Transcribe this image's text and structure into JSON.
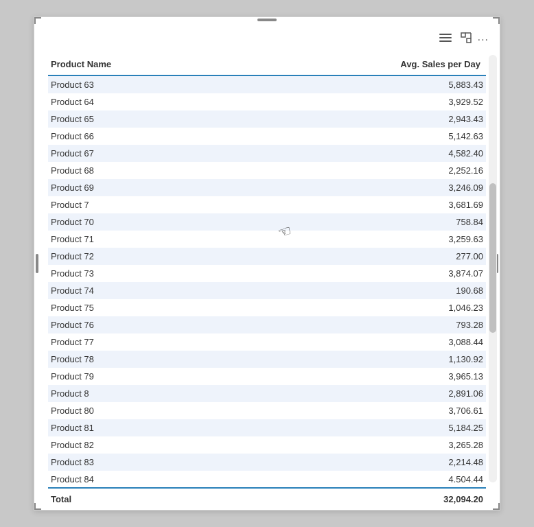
{
  "toolbar": {
    "hamburger_label": "menu",
    "expand_label": "expand",
    "more_label": "..."
  },
  "table": {
    "columns": [
      {
        "key": "product_name",
        "label": "Product Name"
      },
      {
        "key": "avg_sales",
        "label": "Avg. Sales per Day"
      }
    ],
    "rows": [
      {
        "product_name": "Product 63",
        "avg_sales": "5,883.43"
      },
      {
        "product_name": "Product 64",
        "avg_sales": "3,929.52"
      },
      {
        "product_name": "Product 65",
        "avg_sales": "2,943.43"
      },
      {
        "product_name": "Product 66",
        "avg_sales": "5,142.63"
      },
      {
        "product_name": "Product 67",
        "avg_sales": "4,582.40"
      },
      {
        "product_name": "Product 68",
        "avg_sales": "2,252.16"
      },
      {
        "product_name": "Product 69",
        "avg_sales": "3,246.09"
      },
      {
        "product_name": "Product 7",
        "avg_sales": "3,681.69"
      },
      {
        "product_name": "Product 70",
        "avg_sales": "758.84"
      },
      {
        "product_name": "Product 71",
        "avg_sales": "3,259.63"
      },
      {
        "product_name": "Product 72",
        "avg_sales": "277.00"
      },
      {
        "product_name": "Product 73",
        "avg_sales": "3,874.07"
      },
      {
        "product_name": "Product 74",
        "avg_sales": "190.68"
      },
      {
        "product_name": "Product 75",
        "avg_sales": "1,046.23"
      },
      {
        "product_name": "Product 76",
        "avg_sales": "793.28"
      },
      {
        "product_name": "Product 77",
        "avg_sales": "3,088.44"
      },
      {
        "product_name": "Product 78",
        "avg_sales": "1,130.92"
      },
      {
        "product_name": "Product 79",
        "avg_sales": "3,965.13"
      },
      {
        "product_name": "Product 8",
        "avg_sales": "2,891.06"
      },
      {
        "product_name": "Product 80",
        "avg_sales": "3,706.61"
      },
      {
        "product_name": "Product 81",
        "avg_sales": "5,184.25"
      },
      {
        "product_name": "Product 82",
        "avg_sales": "3,265.28"
      },
      {
        "product_name": "Product 83",
        "avg_sales": "2,214.48"
      },
      {
        "product_name": "Product 84",
        "avg_sales": "4,504.44"
      }
    ],
    "total_label": "Total",
    "total_value": "32,094.20"
  }
}
